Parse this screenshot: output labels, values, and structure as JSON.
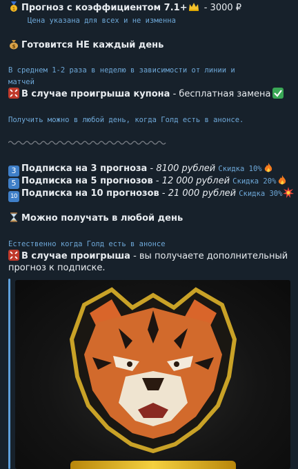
{
  "header": {
    "title_text": "Прогноз с коэффициентом  7.1+",
    "title_price": " - 3000 ₽",
    "subtitle": "Цена указана для всех и не изменна"
  },
  "section1": {
    "heading": "Готовится НЕ каждый день",
    "note_line1": "В среднем 1-2 раза в неделю в зависимости от линии и",
    "note_line2": "матчей",
    "loss_bold": "В случае проигрыша купона",
    "loss_rest": " - бесплатная замена",
    "available": "Получить можно в любой день, когда Голд есть в анонсе."
  },
  "subscriptions": [
    {
      "num": "3",
      "label": "Подписка на 3 прогноза",
      "sep": " - ",
      "price": "8100 рублей",
      "discount": "Скидка 10%",
      "emoji": "fire"
    },
    {
      "num": "5",
      "label": "Подписка на 5 прогнозов",
      "sep": " - ",
      "price": "12 000 рублей",
      "discount": "Скидка  20%",
      "emoji": "fire"
    },
    {
      "num": "10",
      "label": "Подписка на 10 прогнозов",
      "sep": " - ",
      "price": "21 000 рублей",
      "discount": "Скидка  30%",
      "emoji": "boom"
    }
  ],
  "section2": {
    "heading": "Можно получать в любой день",
    "note": "Естественно когда Голд есть в анонсе",
    "loss_bold": "В случае проигрыша",
    "loss_rest_line1": " - вы получаете дополнительный",
    "loss_rest_line2": "прогноз к подписке."
  },
  "icons": {
    "medal": "medal-icon",
    "crown": "crown-icon",
    "moneybag": "money-bag-icon",
    "anger": "anger-icon",
    "check": "check-mark-icon",
    "hourglass": "hourglass-icon",
    "fire": "fire-icon",
    "boom": "collision-icon"
  },
  "colors": {
    "background": "#17212b",
    "text": "#e8ecf0",
    "mono_text": "#6ea8d8",
    "quote_bar": "#5ea0dd",
    "keycap": "#3f7fc8"
  }
}
